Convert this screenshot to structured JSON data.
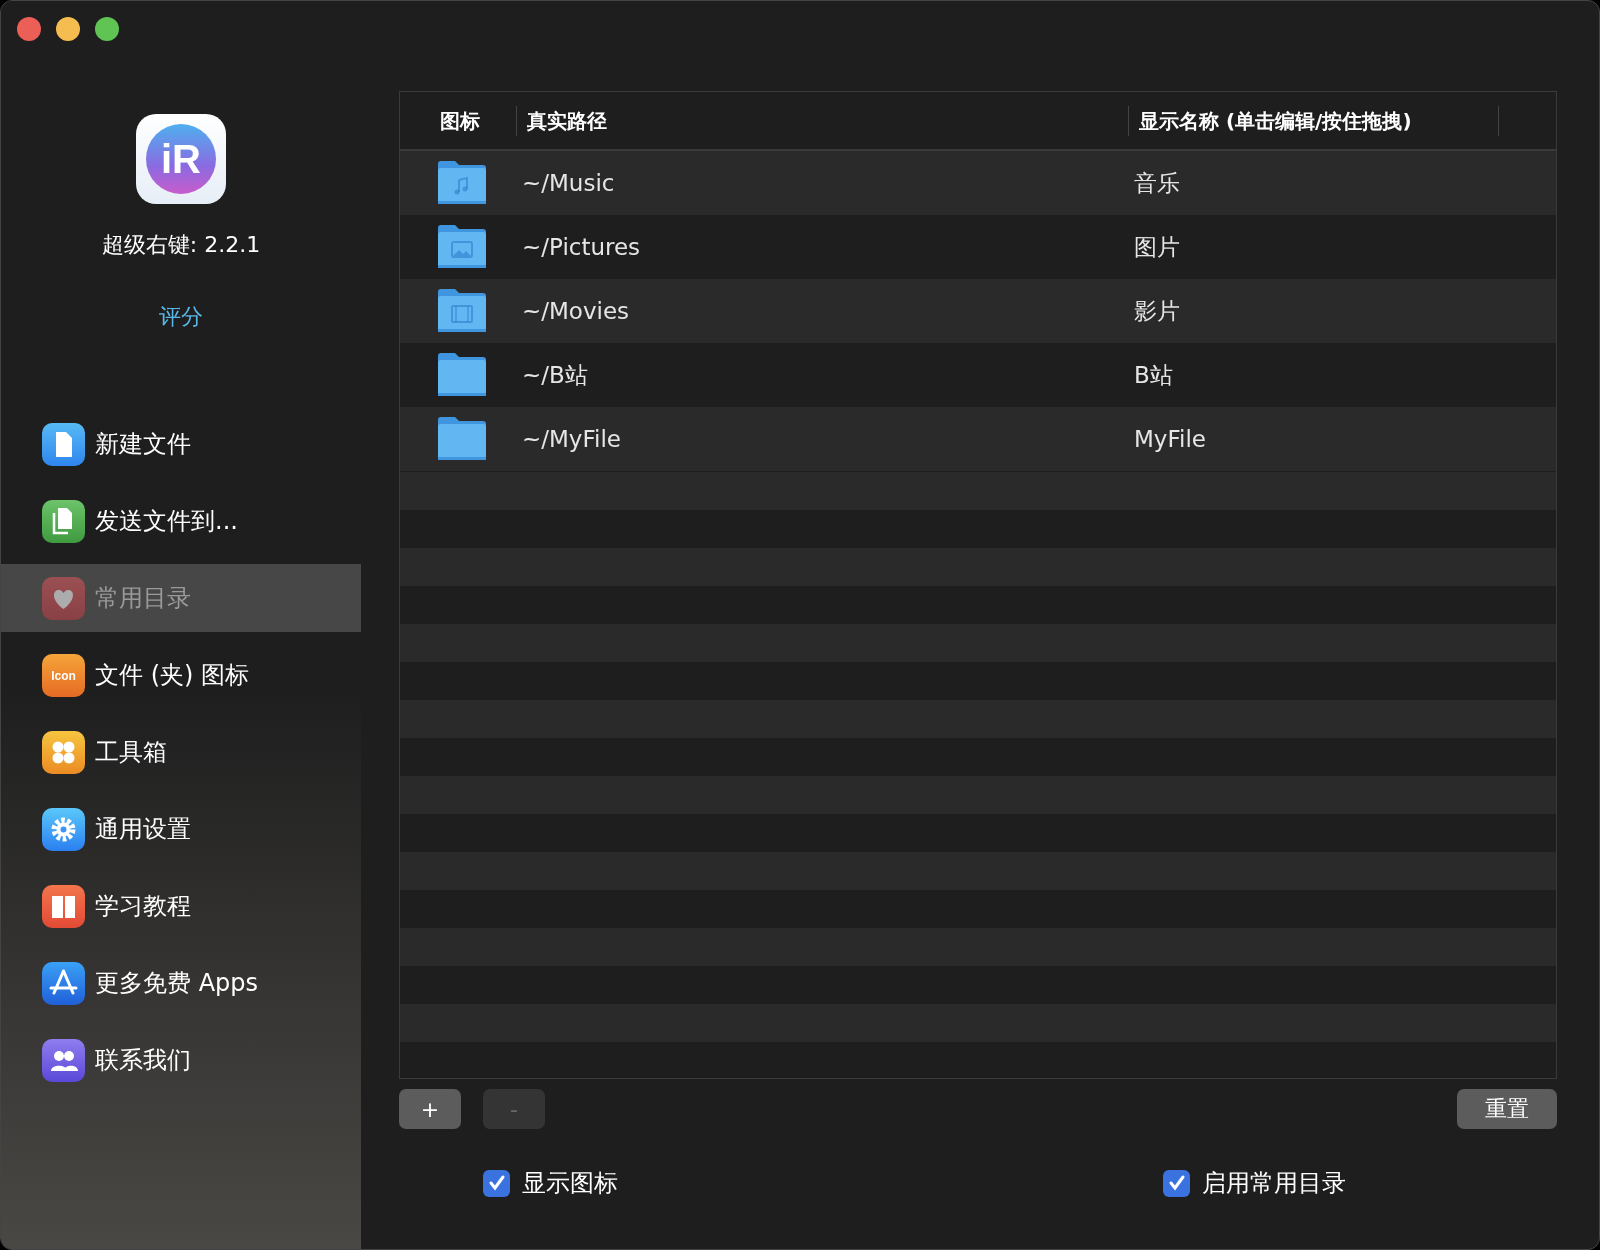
{
  "app": {
    "logo_text": "iR",
    "title": "超级右键: 2.2.1",
    "rate_link": "评分"
  },
  "sidebar": {
    "items": [
      {
        "label": "新建文件",
        "kind": "document",
        "selected": false
      },
      {
        "label": "发送文件到...",
        "kind": "copy",
        "selected": false
      },
      {
        "label": "常用目录",
        "kind": "heart",
        "selected": true
      },
      {
        "label": "文件 (夹) 图标",
        "kind": "icontext",
        "icon_text": "Icon",
        "selected": false
      },
      {
        "label": "工具箱",
        "kind": "clover",
        "selected": false
      },
      {
        "label": "通用设置",
        "kind": "gear",
        "selected": false
      },
      {
        "label": "学习教程",
        "kind": "book",
        "selected": false
      },
      {
        "label": "更多免费 Apps",
        "kind": "appstore",
        "selected": false
      },
      {
        "label": "联系我们",
        "kind": "people",
        "selected": false
      }
    ]
  },
  "table": {
    "columns": [
      "图标",
      "真实路径",
      "显示名称 (单击编辑/按住拖拽)"
    ],
    "rows": [
      {
        "kind": "music",
        "path": "~/Music",
        "name": "音乐"
      },
      {
        "kind": "pictures",
        "path": "~/Pictures",
        "name": "图片"
      },
      {
        "kind": "movies",
        "path": "~/Movies",
        "name": "影片"
      },
      {
        "kind": "plain",
        "path": "~/B站",
        "name": "B站"
      },
      {
        "kind": "plain",
        "path": "~/MyFile",
        "name": "MyFile"
      }
    ]
  },
  "add_button": {
    "label": "+",
    "disabled": false
  },
  "remove_button": {
    "label": "-",
    "disabled": true
  },
  "reset_button": {
    "label": "重置",
    "disabled": false
  },
  "options": [
    {
      "label": "显示图标",
      "checked": true
    },
    {
      "label": "启用常用目录",
      "checked": true
    }
  ]
}
